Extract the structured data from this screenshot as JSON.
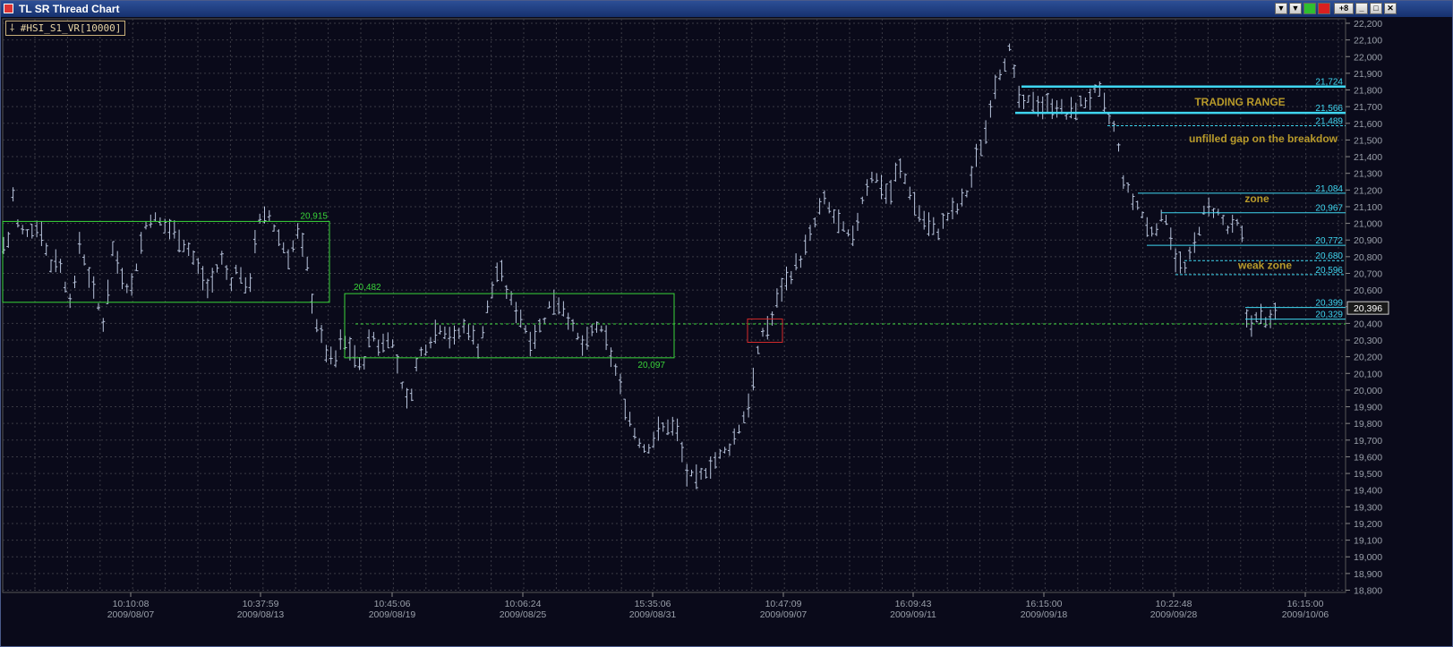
{
  "window": {
    "title": "TL SR Thread Chart",
    "buttons": [
      "▼",
      "▼",
      "",
      "",
      "+8",
      "_",
      "□",
      "✕"
    ],
    "button_names": [
      "dropdown-1",
      "dropdown-2",
      "green-status",
      "red-status",
      "plus8",
      "minimize",
      "maximize",
      "close"
    ]
  },
  "symbol_label": "#HSI_S1_VR[10000]",
  "colors": {
    "background": "#0a0a1a",
    "grid": "#3a3a44",
    "price_bars": "#b8c4dc",
    "box_green": "#39d439",
    "level_cyan": "#3fd6f0",
    "annotation_gold": "#b89a2a",
    "box_red": "#d42a2a"
  },
  "chart_data": {
    "type": "price-bars",
    "y_ticks": [
      "22,200",
      "22,100",
      "22,000",
      "21,900",
      "21,800",
      "21,700",
      "21,600",
      "21,500",
      "21,400",
      "21,300",
      "21,200",
      "21,100",
      "21,000",
      "20,900",
      "20,800",
      "20,700",
      "20,600",
      "20,500",
      "20,400",
      "20,300",
      "20,200",
      "20,100",
      "20,000",
      "19,900",
      "19,800",
      "19,700",
      "19,600",
      "19,500",
      "19,400",
      "19,300",
      "19,200",
      "19,100",
      "19,000",
      "18,900",
      "18,800"
    ],
    "y_tick_values": [
      22200,
      22100,
      22000,
      21900,
      21800,
      21700,
      21600,
      21500,
      21400,
      21300,
      21200,
      21100,
      21000,
      20900,
      20800,
      20700,
      20600,
      20500,
      20400,
      20300,
      20200,
      20100,
      20000,
      19900,
      19800,
      19700,
      19600,
      19500,
      19400,
      19300,
      19200,
      19100,
      19000,
      18900,
      18800
    ],
    "ylim": [
      18750,
      22250
    ],
    "x_ticks": [
      {
        "time": "10:10:08",
        "date": "2009/08/07"
      },
      {
        "time": "10:37:59",
        "date": "2009/08/13"
      },
      {
        "time": "10:45:06",
        "date": "2009/08/19"
      },
      {
        "time": "10:06:24",
        "date": "2009/08/25"
      },
      {
        "time": "15:35:06",
        "date": "2009/08/31"
      },
      {
        "time": "10:47:09",
        "date": "2009/09/07"
      },
      {
        "time": "16:09:43",
        "date": "2009/09/11"
      },
      {
        "time": "16:15:00",
        "date": "2009/09/18"
      },
      {
        "time": "10:22:48",
        "date": "2009/09/28"
      },
      {
        "time": "16:15:00",
        "date": "2009/10/06"
      }
    ],
    "bar_count": 270,
    "price_path": [
      [
        0,
        20750
      ],
      [
        10,
        20820
      ],
      [
        14,
        21100
      ],
      [
        18,
        20900
      ],
      [
        25,
        20850
      ],
      [
        35,
        20880
      ],
      [
        45,
        20870
      ],
      [
        55,
        20650
      ],
      [
        62,
        20700
      ],
      [
        70,
        20600
      ],
      [
        75,
        20450
      ],
      [
        82,
        20500
      ],
      [
        88,
        20800
      ],
      [
        98,
        20600
      ],
      [
        106,
        20450
      ],
      [
        115,
        20300
      ],
      [
        125,
        20750
      ],
      [
        135,
        20600
      ],
      [
        145,
        20500
      ],
      [
        155,
        20750
      ],
      [
        165,
        20950
      ],
      [
        180,
        20900
      ],
      [
        195,
        20850
      ],
      [
        210,
        20750
      ],
      [
        222,
        20620
      ],
      [
        232,
        20500
      ],
      [
        246,
        20700
      ],
      [
        256,
        20550
      ],
      [
        266,
        20650
      ],
      [
        276,
        20450
      ],
      [
        286,
        20900
      ],
      [
        300,
        20950
      ],
      [
        312,
        20800
      ],
      [
        322,
        20700
      ],
      [
        332,
        20850
      ],
      [
        342,
        20650
      ],
      [
        350,
        20350
      ],
      [
        362,
        20150
      ],
      [
        372,
        20050
      ],
      [
        380,
        20200
      ],
      [
        392,
        20150
      ],
      [
        402,
        20020
      ],
      [
        414,
        20250
      ],
      [
        424,
        20150
      ],
      [
        434,
        20250
      ],
      [
        446,
        20000
      ],
      [
        455,
        19800
      ],
      [
        466,
        20100
      ],
      [
        478,
        20200
      ],
      [
        492,
        20300
      ],
      [
        505,
        20200
      ],
      [
        520,
        20300
      ],
      [
        534,
        20150
      ],
      [
        546,
        20450
      ],
      [
        556,
        20650
      ],
      [
        568,
        20450
      ],
      [
        580,
        20350
      ],
      [
        592,
        20200
      ],
      [
        604,
        20300
      ],
      [
        616,
        20450
      ],
      [
        630,
        20400
      ],
      [
        640,
        20250
      ],
      [
        652,
        20150
      ],
      [
        664,
        20300
      ],
      [
        676,
        20200
      ],
      [
        688,
        20000
      ],
      [
        698,
        19800
      ],
      [
        708,
        19650
      ],
      [
        720,
        19550
      ],
      [
        734,
        19650
      ],
      [
        746,
        19700
      ],
      [
        756,
        19650
      ],
      [
        766,
        19400
      ],
      [
        778,
        19350
      ],
      [
        790,
        19450
      ],
      [
        802,
        19500
      ],
      [
        812,
        19550
      ],
      [
        822,
        19650
      ],
      [
        834,
        19800
      ],
      [
        842,
        20000
      ],
      [
        850,
        20250
      ],
      [
        860,
        20300
      ],
      [
        870,
        20500
      ],
      [
        882,
        20600
      ],
      [
        894,
        20700
      ],
      [
        906,
        20850
      ],
      [
        918,
        21050
      ],
      [
        930,
        20950
      ],
      [
        942,
        20850
      ],
      [
        952,
        20800
      ],
      [
        962,
        21050
      ],
      [
        972,
        21200
      ],
      [
        982,
        21150
      ],
      [
        992,
        21050
      ],
      [
        1002,
        21250
      ],
      [
        1012,
        21150
      ],
      [
        1022,
        21000
      ],
      [
        1034,
        20900
      ],
      [
        1046,
        20850
      ],
      [
        1058,
        20950
      ],
      [
        1070,
        21000
      ],
      [
        1080,
        21100
      ],
      [
        1090,
        21300
      ],
      [
        1100,
        21450
      ],
      [
        1108,
        21700
      ],
      [
        1118,
        21850
      ],
      [
        1128,
        21950
      ],
      [
        1134,
        21700
      ],
      [
        1142,
        21600
      ],
      [
        1152,
        21650
      ],
      [
        1165,
        21600
      ],
      [
        1178,
        21620
      ],
      [
        1190,
        21550
      ],
      [
        1202,
        21600
      ],
      [
        1214,
        21650
      ],
      [
        1226,
        21700
      ],
      [
        1236,
        21550
      ],
      [
        1246,
        21450
      ],
      [
        1252,
        21200
      ],
      [
        1262,
        21050
      ],
      [
        1272,
        21000
      ],
      [
        1282,
        20850
      ],
      [
        1292,
        20900
      ],
      [
        1302,
        20950
      ],
      [
        1312,
        20700
      ],
      [
        1322,
        20620
      ],
      [
        1332,
        20750
      ],
      [
        1342,
        20950
      ],
      [
        1352,
        21000
      ],
      [
        1362,
        20950
      ],
      [
        1372,
        20850
      ],
      [
        1380,
        20900
      ],
      [
        1386,
        20850
      ],
      [
        1392,
        20300
      ],
      [
        1400,
        20320
      ],
      [
        1410,
        20350
      ],
      [
        1418,
        20300
      ],
      [
        1426,
        20400
      ]
    ],
    "boxes": [
      {
        "color": "green",
        "top": 20915,
        "bottom": 20430,
        "label": "20,915",
        "label_position": "top-right"
      },
      {
        "color": "green",
        "top": 20482,
        "bottom": 20097,
        "label_top": "20,482",
        "label_bottom": "20,097"
      },
      {
        "color": "red",
        "top": 20330,
        "bottom": 20190
      }
    ],
    "levels": [
      {
        "value": 21724,
        "label": "21,724",
        "style": "solid-thick"
      },
      {
        "value": 21566,
        "label": "21,566",
        "style": "solid-thick"
      },
      {
        "value": 21489,
        "label": "21,489",
        "style": "dashed"
      },
      {
        "value": 21084,
        "label": "21,084",
        "style": "solid"
      },
      {
        "value": 20967,
        "label": "20,967",
        "style": "solid"
      },
      {
        "value": 20772,
        "label": "20,772",
        "style": "solid"
      },
      {
        "value": 20680,
        "label": "20,680",
        "style": "dashed"
      },
      {
        "value": 20596,
        "label": "20,596",
        "style": "dashed"
      },
      {
        "value": 20399,
        "label": "20,399",
        "style": "solid"
      },
      {
        "value": 20329,
        "label": "20,329",
        "style": "solid"
      },
      {
        "value": 20300,
        "label": "",
        "style": "green-dashed"
      }
    ],
    "annotations": [
      {
        "text": "TRADING RANGE",
        "near": 21566
      },
      {
        "text": "unfilled gap on the breakdow",
        "near": 21489
      },
      {
        "text": "zone",
        "near": 21084
      },
      {
        "text": "weak zone",
        "near": 20680
      }
    ],
    "current_price": "20,396",
    "current_value": 20396
  }
}
